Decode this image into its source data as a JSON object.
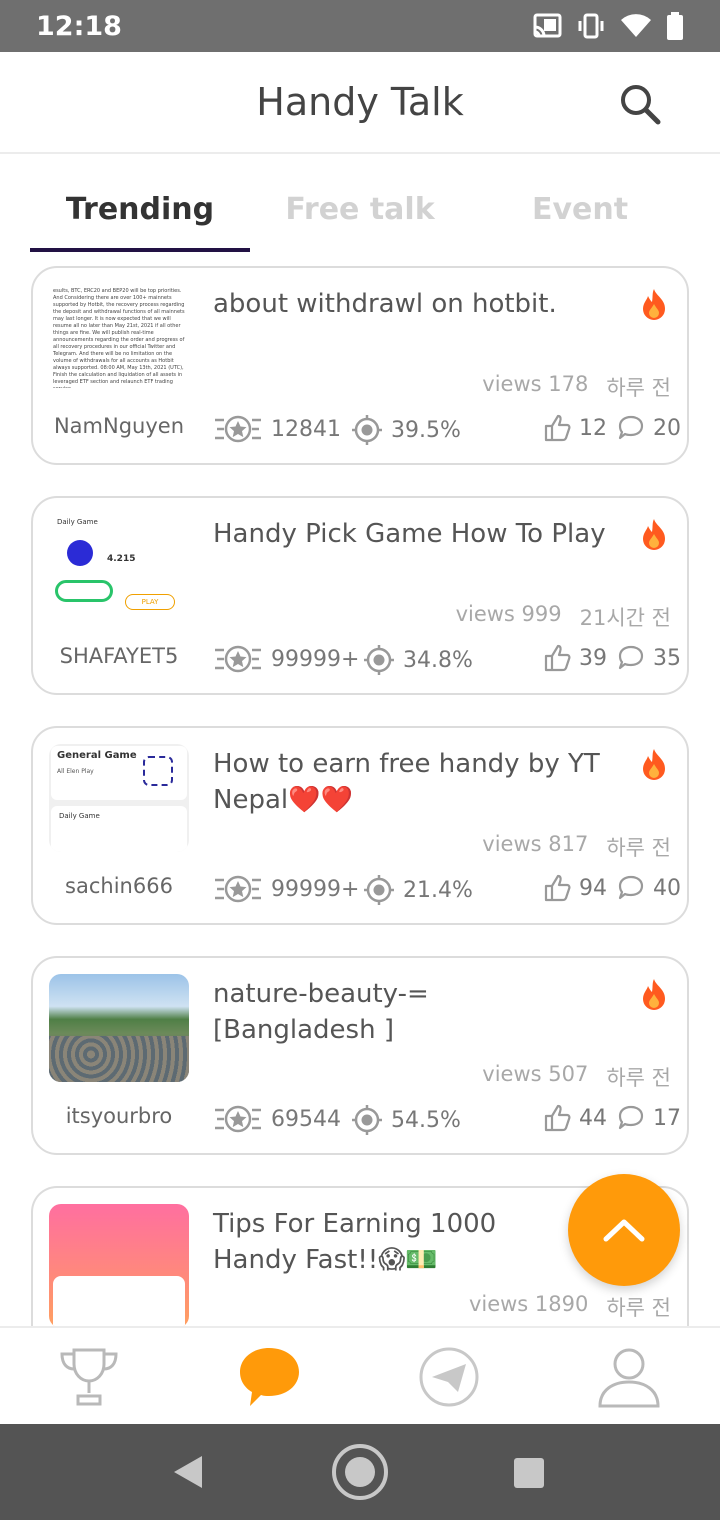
{
  "status_bar": {
    "time": "12:18"
  },
  "app_bar": {
    "title": "Handy Talk",
    "search_icon": "search-icon"
  },
  "tabs": [
    {
      "label": "Trending",
      "active": true
    },
    {
      "label": "Free talk",
      "active": false
    },
    {
      "label": "Event",
      "active": false
    }
  ],
  "posts": [
    {
      "title": "about withdrawl on hotbit.",
      "views": "views 178",
      "time": "하루 전",
      "author": "NamNguyen",
      "points": "12841",
      "rate": "39.5%",
      "likes": "12",
      "comments": "20",
      "thumb": "text-screenshot"
    },
    {
      "title": "Handy Pick Game How To Play",
      "views": "views 999",
      "time": "21시간 전",
      "author": "SHAFAYET5",
      "points": "99999+",
      "rate": "34.8%",
      "likes": "39",
      "comments": "35",
      "thumb": "game-screenshot"
    },
    {
      "title": "How to earn free handy by YT Nepal❤️❤️",
      "views": "views 817",
      "time": "하루 전",
      "author": "sachin666",
      "points": "99999+",
      "rate": "21.4%",
      "likes": "94",
      "comments": "40",
      "thumb": "general-game-screenshot"
    },
    {
      "title": "nature-beauty-=[Bangladesh ]",
      "views": "views 507",
      "time": "하루 전",
      "author": "itsyourbro",
      "points": "69544",
      "rate": "54.5%",
      "likes": "44",
      "comments": "17",
      "thumb": "landscape-photo"
    },
    {
      "title": "Tips For Earning 1000 Handy Fast!!😱💵",
      "views": "views 1890",
      "time": "하루 전",
      "author": "",
      "points": "",
      "rate": "",
      "likes": "",
      "comments": "",
      "thumb": "pink-app-screenshot"
    }
  ],
  "thumb_texts": {
    "text_screenshot": "esults, BTC, ERC20 and BEP20 will be top priorities. And Considering there are over 100+ mainnets supported by Hotbit, the recovery process regarding the deposit and withdrawal functions of all mainnets may last longer. It is now expected that we will resume all no later than May 21st, 2021 if all other things are fine. We will publish real-time announcements regarding the order and progress of all recovery procedures in our official Twitter and Telegram. And there will be no limitation on the volume of withdrawals for all accounts as Hotbit always supported. 08:00 AM, May 13th, 2021 (UTC), Finish the calculation and liquidation of all assets in leveraged ETF section and relaunch ETF trading service",
    "game_daily": "Daily Game",
    "game_value": "4.215",
    "game_play": "PLAY",
    "general_game": "General Game",
    "general_sub": "All Elen Play",
    "daily_game_2": "Daily Game"
  },
  "bottom_nav": [
    {
      "name": "trophy-icon",
      "active": false
    },
    {
      "name": "chat-bubble-icon",
      "active": true
    },
    {
      "name": "paper-plane-icon",
      "active": false
    },
    {
      "name": "profile-icon",
      "active": false
    }
  ],
  "colors": {
    "accent": "#ff9a0a",
    "tab_underline": "#221144",
    "fire": "#ff5a1f"
  }
}
